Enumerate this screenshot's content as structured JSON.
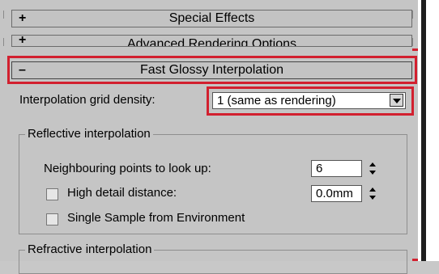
{
  "rollouts": [
    {
      "sign": "+",
      "title": "Special Effects"
    },
    {
      "sign": "+",
      "title": "Advanced Rendering Options"
    },
    {
      "sign": "–",
      "title": "Fast Glossy Interpolation"
    }
  ],
  "grid_density": {
    "label": "Interpolation grid density:",
    "value": "1 (same as rendering)"
  },
  "reflective": {
    "title": "Reflective interpolation",
    "neighbouring_label": "Neighbouring points to look up:",
    "neighbouring_value": "6",
    "high_detail_label": "High detail distance:",
    "high_detail_value": "0.0mm",
    "single_sample_label": "Single Sample from Environment"
  },
  "refractive": {
    "title": "Refractive interpolation"
  },
  "colors": {
    "highlight": "#d2202f",
    "panel": "#c5c5c5"
  }
}
